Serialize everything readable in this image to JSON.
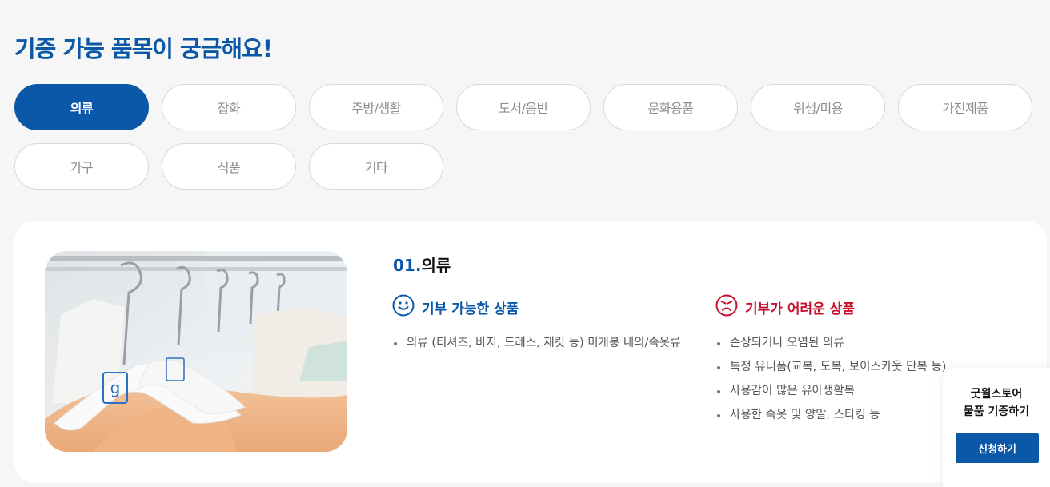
{
  "page_title": "기증 가능 품목이 궁금해요!",
  "categories": [
    "의류",
    "잡화",
    "주방/생활",
    "도서/음반",
    "문화용품",
    "위생/미용",
    "가전제품",
    "가구",
    "식품",
    "기타"
  ],
  "active_category": "의류",
  "detail": {
    "number": "01.",
    "name": "의류",
    "photo_icon": "clothes-hanger-photo",
    "donatable": {
      "title": "기부 가능한 상품",
      "icon": "smile-icon",
      "color": "#0b57a8",
      "items": [
        "의류 (티셔츠, 바지, 드레스, 재킷 등) 미개봉 내의/속옷류"
      ]
    },
    "not_donatable": {
      "title": "기부가 어려운 상품",
      "icon": "angry-face-icon",
      "color": "#c8102e",
      "items": [
        "손상되거나 오염된 의류",
        "특정 유니폼(교복, 도복, 보이스카웃 단복 등)",
        "사용감이 많은 유아생활복",
        "사용한 속옷 및 양말, 스타킹 등"
      ]
    }
  },
  "floating": {
    "line1": "굿윌스토어",
    "line2": "물품 기증하기",
    "button": "신청하기"
  },
  "colors": {
    "brand_blue": "#0b57a8",
    "alert_red": "#c8102e"
  }
}
